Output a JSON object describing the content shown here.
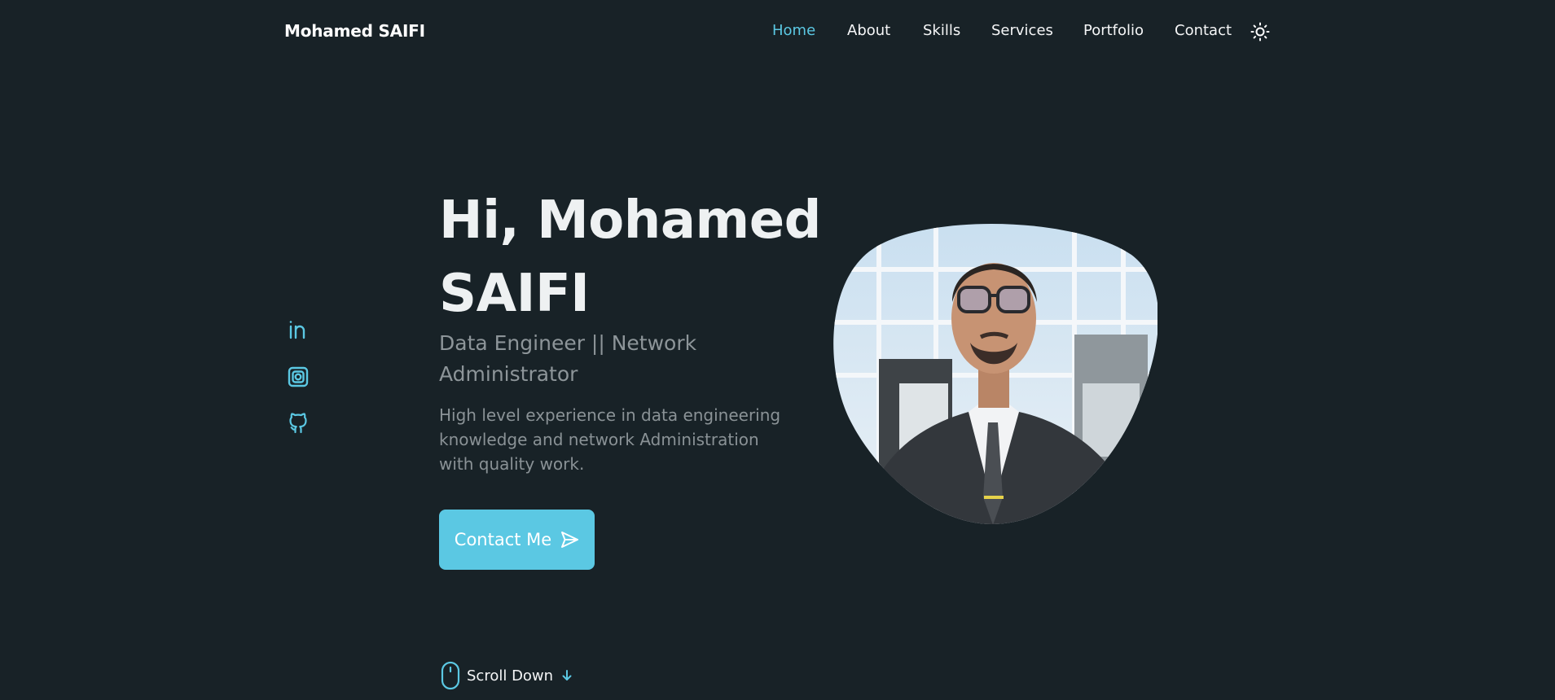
{
  "header": {
    "logo": "Mohamed SAIFI",
    "nav": [
      {
        "label": "Home",
        "active": true
      },
      {
        "label": "About",
        "active": false
      },
      {
        "label": "Skills",
        "active": false
      },
      {
        "label": "Services",
        "active": false
      },
      {
        "label": "Portfolio",
        "active": false
      },
      {
        "label": "Contact",
        "active": false
      }
    ],
    "theme_icon": "sun-icon"
  },
  "social": [
    {
      "icon": "linkedin-icon"
    },
    {
      "icon": "instagram-icon"
    },
    {
      "icon": "github-icon"
    }
  ],
  "hero": {
    "title_line1": "Hi, Mohamed",
    "title_line2": "SAIFI",
    "subtitle": "Data Engineer || Network Administrator",
    "description": "High level experience in data engineering knowledge and network Administration with quality work.",
    "button_label": "Contact Me",
    "button_icon": "send-icon",
    "scroll_label": "Scroll Down",
    "scroll_icons": [
      "mouse-icon",
      "arrow-down-icon"
    ]
  },
  "colors": {
    "background": "#182227",
    "accent": "#5bc8e3",
    "text": "#f1f3f4",
    "muted": "#8d9599"
  }
}
